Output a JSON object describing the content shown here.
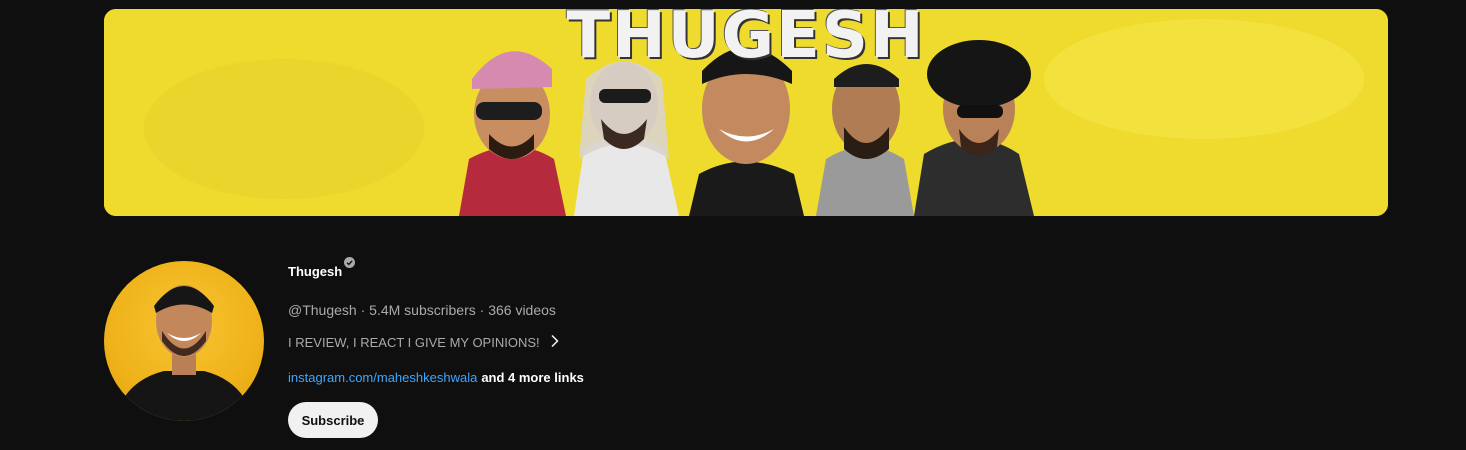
{
  "banner": {
    "title": "THUGESH"
  },
  "channel": {
    "name": "Thugesh",
    "verified": true,
    "handle": "@Thugesh",
    "subscribers": "5.4M subscribers",
    "videos": "366 videos",
    "description": "I REVIEW, I REACT I GIVE MY OPINIONS!",
    "link": "instagram.com/maheshkeshwala",
    "more_links": "and 4 more links",
    "subscribe_label": "Subscribe"
  },
  "separators": {
    "dot": " · "
  },
  "icons": {
    "verified": "verified-check-icon",
    "description_expand": "chevron-right-icon"
  },
  "colors": {
    "background": "#0f0f0f",
    "link": "#3ea6ff",
    "secondary_text": "#aaaaaa",
    "banner_yellow": "#f1de33",
    "avatar_yellow": "#efb21a",
    "button_bg": "#f1f1f1"
  }
}
